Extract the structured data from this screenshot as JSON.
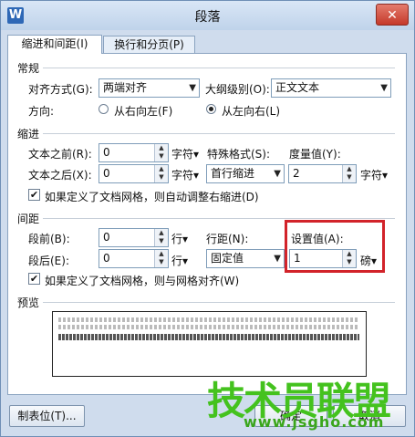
{
  "window": {
    "title": "段落",
    "logo": "W",
    "close_glyph": "✕"
  },
  "tabs": [
    {
      "label": "缩进和间距(I)",
      "active": true
    },
    {
      "label": "换行和分页(P)",
      "active": false
    }
  ],
  "general": {
    "heading": "常规",
    "alignment_label": "对齐方式(G):",
    "alignment_value": "两端对齐",
    "outline_label": "大纲级别(O):",
    "outline_value": "正文文本",
    "direction_label": "方向:",
    "rtl_label": "从右向左(F)",
    "ltr_label": "从左向右(L)"
  },
  "indent": {
    "heading": "缩进",
    "before_label": "文本之前(R):",
    "before_value": "0",
    "before_unit": "字符▾",
    "after_label": "文本之后(X):",
    "after_value": "0",
    "after_unit": "字符▾",
    "special_label": "特殊格式(S):",
    "special_value": "首行缩进",
    "measure_label": "度量值(Y):",
    "measure_value": "2",
    "measure_unit": "字符▾",
    "auto_adjust_label": "如果定义了文档网格，则自动调整右缩进(D)"
  },
  "spacing": {
    "heading": "间距",
    "before_label": "段前(B):",
    "before_value": "0",
    "before_unit": "行▾",
    "after_label": "段后(E):",
    "after_value": "0",
    "after_unit": "行▾",
    "line_label": "行距(N):",
    "line_value": "固定值",
    "setting_label": "设置值(A):",
    "setting_value": "1",
    "setting_unit": "磅▾",
    "snap_label": "如果定义了文档网格，则与网格对齐(W)"
  },
  "preview": {
    "heading": "预览"
  },
  "footer": {
    "tabs_button": "制表位(T)...",
    "ok_button": "确定",
    "cancel_button": "取消"
  },
  "watermark": {
    "main": "技术员联盟",
    "url": "www.jsgho.com"
  }
}
